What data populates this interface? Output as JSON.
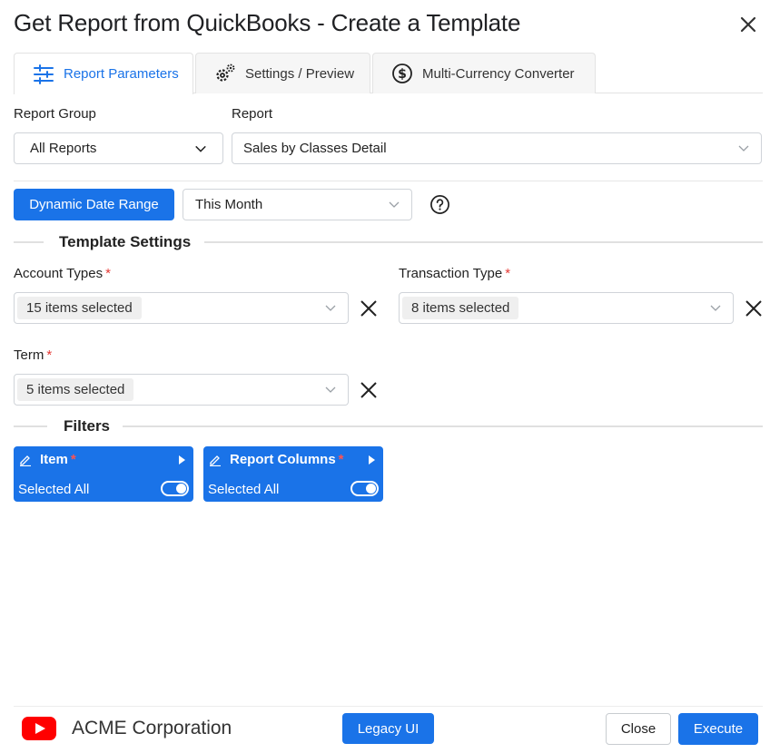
{
  "dialog": {
    "title": "Get Report from QuickBooks - Create a Template"
  },
  "tabs": [
    {
      "label": "Report Parameters",
      "icon": "sliders-icon",
      "active": true
    },
    {
      "label": "Settings / Preview",
      "icon": "gears-icon",
      "active": false
    },
    {
      "label": "Multi-Currency Converter",
      "icon": "dollar-circle-icon",
      "active": false
    }
  ],
  "report_group": {
    "label": "Report Group",
    "value": "All Reports"
  },
  "report": {
    "label": "Report",
    "value": "Sales by Classes Detail"
  },
  "date_range": {
    "button_label": "Dynamic Date Range",
    "value": "This Month"
  },
  "template_settings": {
    "title": "Template Settings",
    "account_types": {
      "label": "Account Types",
      "required_mark": "*",
      "selected": "15 items selected"
    },
    "transaction_type": {
      "label": "Transaction Type",
      "required_mark": "*",
      "selected": "8 items selected"
    },
    "term": {
      "label": "Term",
      "required_mark": "*",
      "selected": "5 items selected"
    }
  },
  "filters": {
    "title": "Filters",
    "cards": [
      {
        "title": "Item",
        "required_mark": "*",
        "status": "Selected All",
        "toggle_on": true
      },
      {
        "title": "Report Columns",
        "required_mark": "*",
        "status": "Selected All",
        "toggle_on": true
      }
    ]
  },
  "footer": {
    "brand": "ACME Corporation",
    "legacy_label": "Legacy UI",
    "close_label": "Close",
    "execute_label": "Execute"
  },
  "colors": {
    "accent": "#1a73e8",
    "required": "#e53935",
    "logo_red": "#ff0000"
  }
}
